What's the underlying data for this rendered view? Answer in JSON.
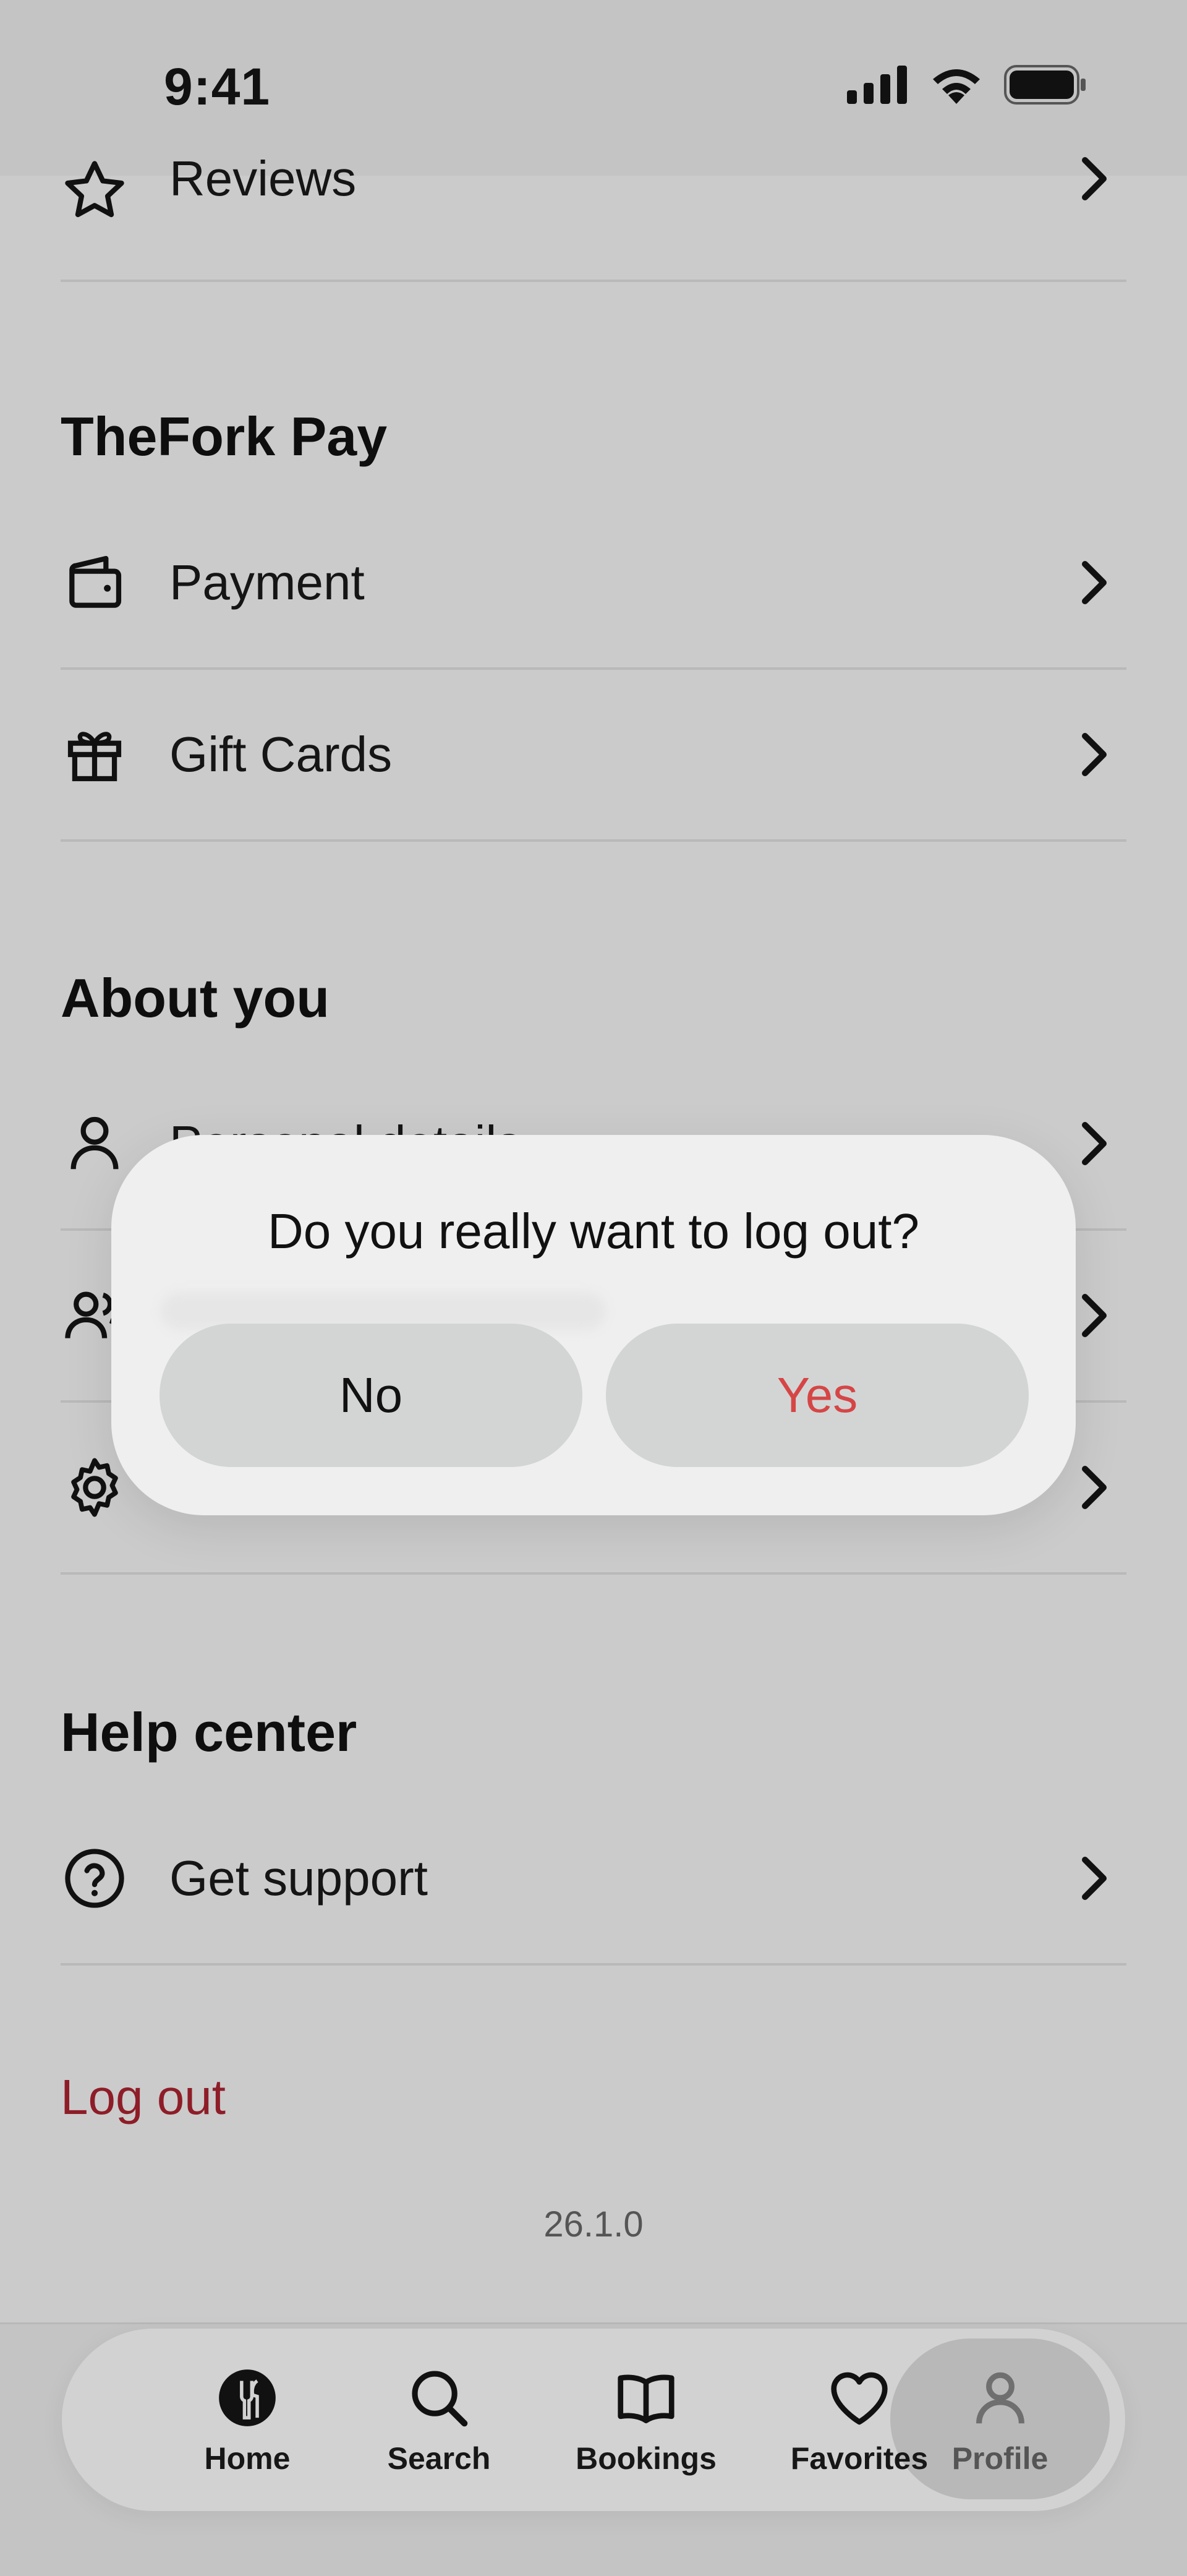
{
  "status_bar": {
    "time": "9:41"
  },
  "sections": {
    "reviews": {
      "label": "Reviews"
    },
    "thefork_pay": {
      "title": "TheFork Pay",
      "items": [
        {
          "label": "Payment",
          "icon": "wallet-icon"
        },
        {
          "label": "Gift Cards",
          "icon": "gift-icon"
        }
      ]
    },
    "about_you": {
      "title": "About you",
      "items": [
        {
          "label": "Personal details",
          "icon": "person-icon"
        },
        {
          "label": "",
          "icon": "people-icon"
        },
        {
          "label": "",
          "icon": "gear-icon"
        }
      ]
    },
    "help_center": {
      "title": "Help center",
      "items": [
        {
          "label": "Get support",
          "icon": "question-icon"
        }
      ]
    }
  },
  "logout_label": "Log out",
  "version": "26.1.0",
  "tabbar": {
    "tabs": [
      {
        "label": "Home",
        "icon": "fork-icon"
      },
      {
        "label": "Search",
        "icon": "search-icon"
      },
      {
        "label": "Bookings",
        "icon": "book-icon"
      },
      {
        "label": "Favorites",
        "icon": "heart-icon"
      },
      {
        "label": "Profile",
        "icon": "profile-icon",
        "active": true
      }
    ]
  },
  "modal": {
    "title": "Do you really want to log out?",
    "no_label": "No",
    "yes_label": "Yes"
  },
  "colors": {
    "background": "#cbcbcb",
    "logout": "#8e1d28",
    "yes": "#d64545",
    "modal": "#efefef"
  }
}
